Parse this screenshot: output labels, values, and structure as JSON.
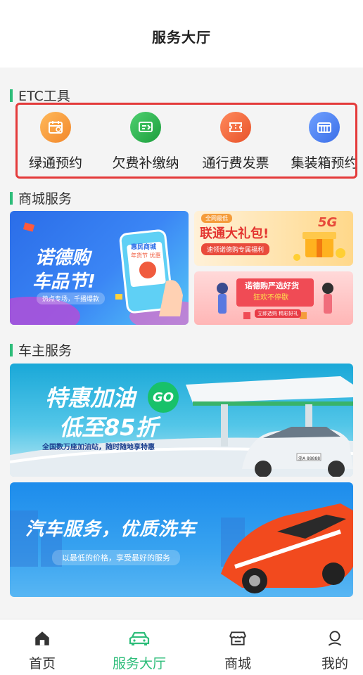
{
  "header": {
    "title": "服务大厅"
  },
  "sections": {
    "etc": "ETC工具",
    "mall": "商城服务",
    "owner": "车主服务"
  },
  "etc_tools": [
    {
      "label": "绿通预约",
      "icon": "calendar-icon",
      "color": "#f59c3a"
    },
    {
      "label": "欠费补缴纳",
      "icon": "payment-icon",
      "color": "#26b24c"
    },
    {
      "label": "通行费发票",
      "icon": "ticket-icon",
      "color": "#f26a3f"
    },
    {
      "label": "集装箱预约",
      "icon": "container-icon",
      "color": "#4a7ff2"
    }
  ],
  "mall": {
    "main": {
      "title_line1": "诺德购",
      "title_line2": "车品节!",
      "subtitle": "热点专场，千播爆款",
      "phone_title": "惠民商城",
      "phone_subtitle": "年货节 优惠"
    },
    "top_right": {
      "title": "联通大礼包!",
      "subtitle": "速领诺德购专属福利",
      "tag": "全网最低",
      "badge": "5G"
    },
    "bottom_right": {
      "title_line1": "诺德购严选好货",
      "title_line2": "狂欢不停歇",
      "cta": "立即选购 精彩好礼"
    }
  },
  "owner": {
    "fuel": {
      "title_line1": "特惠加油",
      "title_line2": "低至85折",
      "badge": "GO",
      "subtitle": "全国数万座加油站，随时随地享特惠",
      "plate": "浙A 88888"
    },
    "wash": {
      "title": "汽车服务，优质洗车",
      "subtitle": "以最低的价格，享受最好的服务"
    }
  },
  "tabbar": [
    {
      "label": "首页",
      "icon": "home-icon"
    },
    {
      "label": "服务大厅",
      "icon": "car-icon",
      "active": true
    },
    {
      "label": "商城",
      "icon": "store-icon"
    },
    {
      "label": "我的",
      "icon": "user-icon"
    }
  ],
  "colors": {
    "accent": "#2ebd7a",
    "highlight_border": "#e43a3a"
  }
}
